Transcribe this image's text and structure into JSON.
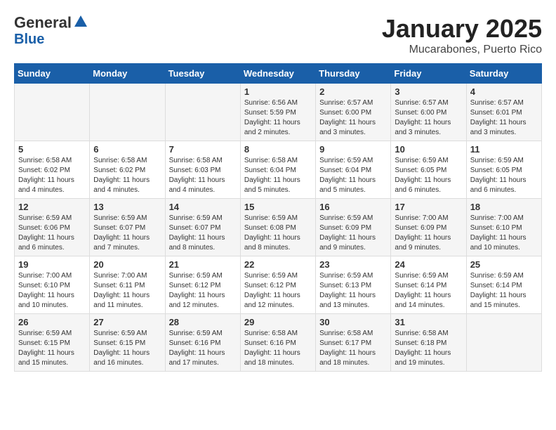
{
  "header": {
    "logo_line1": "General",
    "logo_line2": "Blue",
    "month": "January 2025",
    "location": "Mucarabones, Puerto Rico"
  },
  "weekdays": [
    "Sunday",
    "Monday",
    "Tuesday",
    "Wednesday",
    "Thursday",
    "Friday",
    "Saturday"
  ],
  "weeks": [
    [
      {
        "day": "",
        "sunrise": "",
        "sunset": "",
        "daylight": ""
      },
      {
        "day": "",
        "sunrise": "",
        "sunset": "",
        "daylight": ""
      },
      {
        "day": "",
        "sunrise": "",
        "sunset": "",
        "daylight": ""
      },
      {
        "day": "1",
        "sunrise": "Sunrise: 6:56 AM",
        "sunset": "Sunset: 5:59 PM",
        "daylight": "Daylight: 11 hours and 2 minutes."
      },
      {
        "day": "2",
        "sunrise": "Sunrise: 6:57 AM",
        "sunset": "Sunset: 6:00 PM",
        "daylight": "Daylight: 11 hours and 3 minutes."
      },
      {
        "day": "3",
        "sunrise": "Sunrise: 6:57 AM",
        "sunset": "Sunset: 6:00 PM",
        "daylight": "Daylight: 11 hours and 3 minutes."
      },
      {
        "day": "4",
        "sunrise": "Sunrise: 6:57 AM",
        "sunset": "Sunset: 6:01 PM",
        "daylight": "Daylight: 11 hours and 3 minutes."
      }
    ],
    [
      {
        "day": "5",
        "sunrise": "Sunrise: 6:58 AM",
        "sunset": "Sunset: 6:02 PM",
        "daylight": "Daylight: 11 hours and 4 minutes."
      },
      {
        "day": "6",
        "sunrise": "Sunrise: 6:58 AM",
        "sunset": "Sunset: 6:02 PM",
        "daylight": "Daylight: 11 hours and 4 minutes."
      },
      {
        "day": "7",
        "sunrise": "Sunrise: 6:58 AM",
        "sunset": "Sunset: 6:03 PM",
        "daylight": "Daylight: 11 hours and 4 minutes."
      },
      {
        "day": "8",
        "sunrise": "Sunrise: 6:58 AM",
        "sunset": "Sunset: 6:04 PM",
        "daylight": "Daylight: 11 hours and 5 minutes."
      },
      {
        "day": "9",
        "sunrise": "Sunrise: 6:59 AM",
        "sunset": "Sunset: 6:04 PM",
        "daylight": "Daylight: 11 hours and 5 minutes."
      },
      {
        "day": "10",
        "sunrise": "Sunrise: 6:59 AM",
        "sunset": "Sunset: 6:05 PM",
        "daylight": "Daylight: 11 hours and 6 minutes."
      },
      {
        "day": "11",
        "sunrise": "Sunrise: 6:59 AM",
        "sunset": "Sunset: 6:05 PM",
        "daylight": "Daylight: 11 hours and 6 minutes."
      }
    ],
    [
      {
        "day": "12",
        "sunrise": "Sunrise: 6:59 AM",
        "sunset": "Sunset: 6:06 PM",
        "daylight": "Daylight: 11 hours and 6 minutes."
      },
      {
        "day": "13",
        "sunrise": "Sunrise: 6:59 AM",
        "sunset": "Sunset: 6:07 PM",
        "daylight": "Daylight: 11 hours and 7 minutes."
      },
      {
        "day": "14",
        "sunrise": "Sunrise: 6:59 AM",
        "sunset": "Sunset: 6:07 PM",
        "daylight": "Daylight: 11 hours and 8 minutes."
      },
      {
        "day": "15",
        "sunrise": "Sunrise: 6:59 AM",
        "sunset": "Sunset: 6:08 PM",
        "daylight": "Daylight: 11 hours and 8 minutes."
      },
      {
        "day": "16",
        "sunrise": "Sunrise: 6:59 AM",
        "sunset": "Sunset: 6:09 PM",
        "daylight": "Daylight: 11 hours and 9 minutes."
      },
      {
        "day": "17",
        "sunrise": "Sunrise: 7:00 AM",
        "sunset": "Sunset: 6:09 PM",
        "daylight": "Daylight: 11 hours and 9 minutes."
      },
      {
        "day": "18",
        "sunrise": "Sunrise: 7:00 AM",
        "sunset": "Sunset: 6:10 PM",
        "daylight": "Daylight: 11 hours and 10 minutes."
      }
    ],
    [
      {
        "day": "19",
        "sunrise": "Sunrise: 7:00 AM",
        "sunset": "Sunset: 6:10 PM",
        "daylight": "Daylight: 11 hours and 10 minutes."
      },
      {
        "day": "20",
        "sunrise": "Sunrise: 7:00 AM",
        "sunset": "Sunset: 6:11 PM",
        "daylight": "Daylight: 11 hours and 11 minutes."
      },
      {
        "day": "21",
        "sunrise": "Sunrise: 6:59 AM",
        "sunset": "Sunset: 6:12 PM",
        "daylight": "Daylight: 11 hours and 12 minutes."
      },
      {
        "day": "22",
        "sunrise": "Sunrise: 6:59 AM",
        "sunset": "Sunset: 6:12 PM",
        "daylight": "Daylight: 11 hours and 12 minutes."
      },
      {
        "day": "23",
        "sunrise": "Sunrise: 6:59 AM",
        "sunset": "Sunset: 6:13 PM",
        "daylight": "Daylight: 11 hours and 13 minutes."
      },
      {
        "day": "24",
        "sunrise": "Sunrise: 6:59 AM",
        "sunset": "Sunset: 6:14 PM",
        "daylight": "Daylight: 11 hours and 14 minutes."
      },
      {
        "day": "25",
        "sunrise": "Sunrise: 6:59 AM",
        "sunset": "Sunset: 6:14 PM",
        "daylight": "Daylight: 11 hours and 15 minutes."
      }
    ],
    [
      {
        "day": "26",
        "sunrise": "Sunrise: 6:59 AM",
        "sunset": "Sunset: 6:15 PM",
        "daylight": "Daylight: 11 hours and 15 minutes."
      },
      {
        "day": "27",
        "sunrise": "Sunrise: 6:59 AM",
        "sunset": "Sunset: 6:15 PM",
        "daylight": "Daylight: 11 hours and 16 minutes."
      },
      {
        "day": "28",
        "sunrise": "Sunrise: 6:59 AM",
        "sunset": "Sunset: 6:16 PM",
        "daylight": "Daylight: 11 hours and 17 minutes."
      },
      {
        "day": "29",
        "sunrise": "Sunrise: 6:58 AM",
        "sunset": "Sunset: 6:16 PM",
        "daylight": "Daylight: 11 hours and 18 minutes."
      },
      {
        "day": "30",
        "sunrise": "Sunrise: 6:58 AM",
        "sunset": "Sunset: 6:17 PM",
        "daylight": "Daylight: 11 hours and 18 minutes."
      },
      {
        "day": "31",
        "sunrise": "Sunrise: 6:58 AM",
        "sunset": "Sunset: 6:18 PM",
        "daylight": "Daylight: 11 hours and 19 minutes."
      },
      {
        "day": "",
        "sunrise": "",
        "sunset": "",
        "daylight": ""
      }
    ]
  ]
}
